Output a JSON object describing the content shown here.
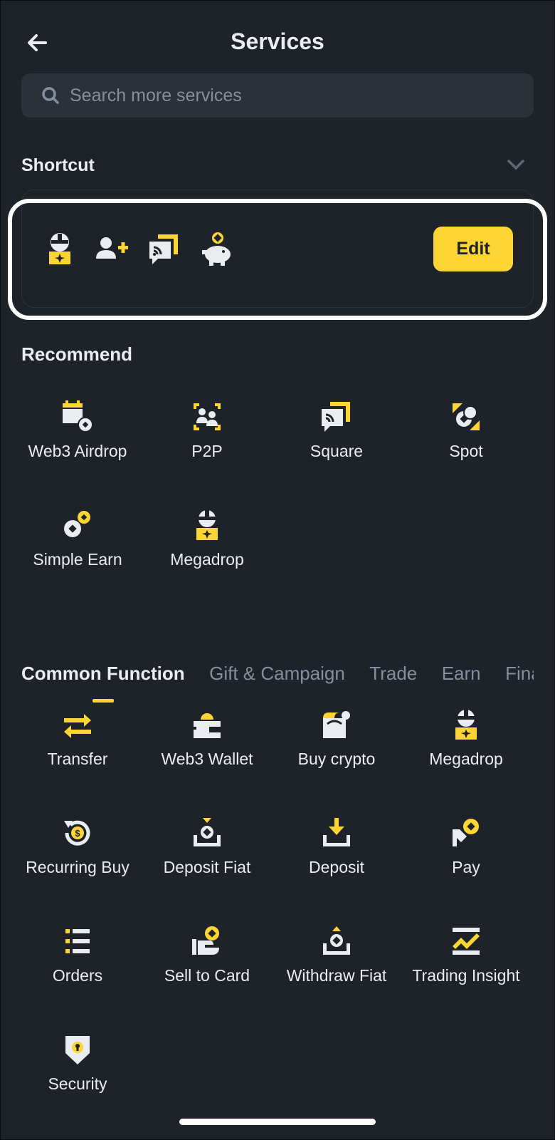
{
  "header": {
    "title": "Services"
  },
  "search": {
    "placeholder": "Search more services"
  },
  "shortcut": {
    "title": "Shortcut",
    "edit_label": "Edit",
    "icons": [
      "megadrop-icon",
      "add-user-icon",
      "square-icon",
      "piggy-bank-icon"
    ]
  },
  "recommend": {
    "title": "Recommend",
    "items": [
      {
        "label": "Web3 Airdrop",
        "icon": "web3-airdrop-icon"
      },
      {
        "label": "P2P",
        "icon": "p2p-icon"
      },
      {
        "label": "Square",
        "icon": "square-icon"
      },
      {
        "label": "Spot",
        "icon": "spot-icon"
      },
      {
        "label": "Simple Earn",
        "icon": "simple-earn-icon"
      },
      {
        "label": "Megadrop",
        "icon": "megadrop-icon"
      }
    ]
  },
  "tabs": [
    {
      "label": "Common Function",
      "active": true
    },
    {
      "label": "Gift & Campaign",
      "active": false
    },
    {
      "label": "Trade",
      "active": false
    },
    {
      "label": "Earn",
      "active": false
    },
    {
      "label": "Finance",
      "active": false
    }
  ],
  "common": {
    "items": [
      {
        "label": "Transfer",
        "icon": "transfer-icon"
      },
      {
        "label": "Web3 Wallet",
        "icon": "web3-wallet-icon"
      },
      {
        "label": "Buy crypto",
        "icon": "buy-crypto-icon"
      },
      {
        "label": "Megadrop",
        "icon": "megadrop-icon"
      },
      {
        "label": "Recurring Buy",
        "icon": "recurring-buy-icon"
      },
      {
        "label": "Deposit Fiat",
        "icon": "deposit-fiat-icon"
      },
      {
        "label": "Deposit",
        "icon": "deposit-icon"
      },
      {
        "label": "Pay",
        "icon": "pay-icon"
      },
      {
        "label": "Orders",
        "icon": "orders-icon"
      },
      {
        "label": "Sell to Card",
        "icon": "sell-to-card-icon"
      },
      {
        "label": "Withdraw Fiat",
        "icon": "withdraw-fiat-icon"
      },
      {
        "label": "Trading Insight",
        "icon": "trading-insight-icon"
      },
      {
        "label": "Security",
        "icon": "security-icon"
      }
    ]
  },
  "colors": {
    "background": "#1e2329",
    "accent": "#fcd535",
    "text": "#eaecef",
    "muted": "#848e9c"
  }
}
